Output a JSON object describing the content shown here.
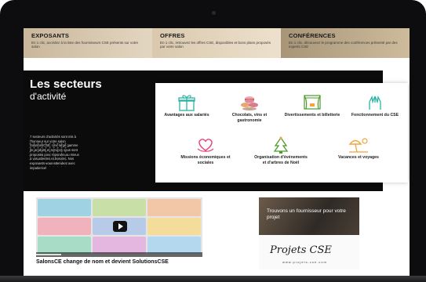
{
  "banner": [
    {
      "title": "EXPOSANTS",
      "text": "En 1 clic, accédez à la liste des fournisseurs CSE présents sur votre salon"
    },
    {
      "title": "OFFRES",
      "text": "En 1 clic, retrouvez les offres CSE, disponibles et bons plans proposés par votre salon"
    },
    {
      "title": "CONFÉRENCES",
      "text": "En 1 clic, découvrez le programme des conférences présenté par des experts CSE"
    }
  ],
  "sectors": {
    "title": "Les secteurs",
    "subtitle": "d'activité",
    "description": "7 secteurs d'activités sont mis à l'honneur sur votre salon SolutionsCSE. Une large gamme de produits et services vous sont proposés pour répondre au mieux à vos attentes et besoins. Nos exposants vous attendent avec impatience!",
    "items": [
      {
        "label": "Avantages aux salariés",
        "icon": "gift-icon"
      },
      {
        "label": "Chocolats, vins et gastronomie",
        "icon": "macarons-icon"
      },
      {
        "label": "Divertissements et billetterie",
        "icon": "theater-icon"
      },
      {
        "label": "Fonctionnement du CSE",
        "icon": "hands-icon"
      },
      {
        "label": "Missions économiques et sociales",
        "icon": "heart-hands-icon"
      },
      {
        "label": "Organisation d'événements et d'arbres de Noël",
        "icon": "christmas-tree-icon"
      },
      {
        "label": "Vacances et voyages",
        "icon": "beach-umbrella-icon"
      }
    ]
  },
  "video": {
    "caption": "SalonsCE change de nom et devient SolutionsCSE",
    "progress": 0.15
  },
  "ad": {
    "headline": "Trouvons un fournisseur pour votre projet",
    "logo": "Projets CSE",
    "url": "www.projets-cse.com"
  },
  "colors": {
    "accent": "#2bb3a3",
    "pink": "#e8437a",
    "orange": "#f4a43a",
    "green": "#4e9a2a"
  }
}
